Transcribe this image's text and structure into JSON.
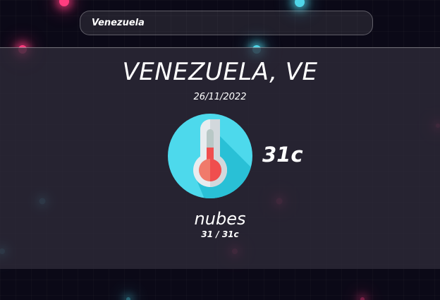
{
  "search": {
    "value": "Venezuela",
    "icon": "search-input"
  },
  "weather": {
    "city": "VENEZUELA, VE",
    "date": "26/11/2022",
    "icon": "thermometer-icon",
    "temperature": "31c",
    "description": "nubes",
    "min_max": "31 / 31c"
  },
  "colors": {
    "background": "#0b0917",
    "panel": "#2e2a38",
    "accent_pink": "#ff3d7f",
    "accent_blue": "#4fd6e8",
    "icon_circle": "#4dd9ec",
    "thermo_red": "#f04e4e"
  }
}
